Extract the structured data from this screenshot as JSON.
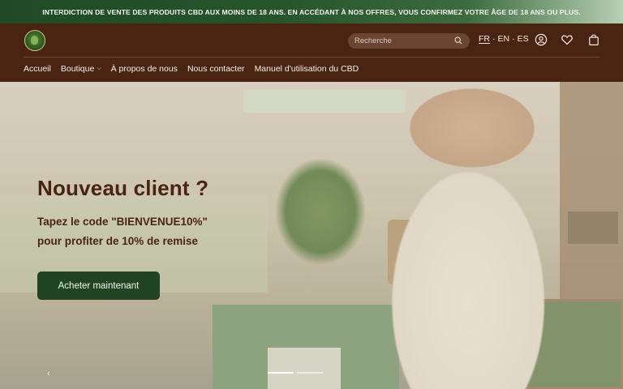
{
  "announcement": "INTERDICTION DE VENTE DES PRODUITS CBD AUX MOINS DE 18 ANS. EN ACCÉDANT À NOS OFFRES, VOUS CONFIRMEZ VOTRE ÂGE DE 18 ANS OU PLUS.",
  "header": {
    "search_placeholder": "Recherche",
    "languages": [
      "FR",
      "EN",
      "ES"
    ],
    "lang_separator": "·",
    "icons": [
      "search-icon",
      "account-icon",
      "wishlist-heart-icon",
      "cart-bag-icon"
    ]
  },
  "nav": {
    "items": [
      {
        "label": "Accueil"
      },
      {
        "label": "Boutique",
        "chevron": "⌵"
      },
      {
        "label": "À propos de nous"
      },
      {
        "label": "Nous contacter"
      },
      {
        "label": "Manuel d'utilisation du CBD"
      }
    ]
  },
  "hero": {
    "title": "Nouveau client ?",
    "line1": "Tapez le code \"BIENVENUE10%\"",
    "line2": "pour profiter de 10% de remise",
    "cta": "Acheter maintenant",
    "prev_arrow": "‹",
    "slides_total": 2,
    "slide_active": 1
  },
  "colors": {
    "announcement_bg": "#1f4a25",
    "header_bg": "#4a2412",
    "hero_text": "#4a2412",
    "cta_bg": "#214523"
  }
}
